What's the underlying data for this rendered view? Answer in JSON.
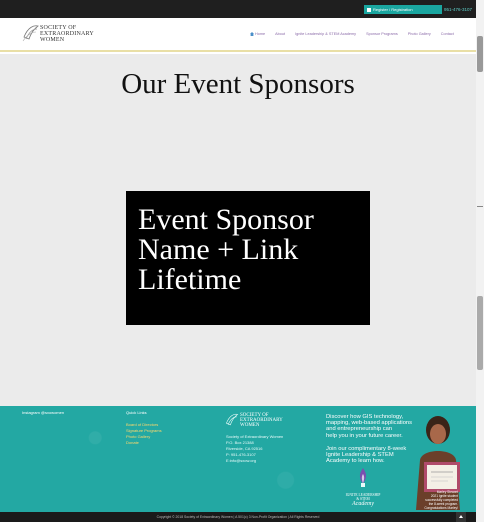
{
  "topbar": {
    "register_label": "Register / Registration",
    "phone": "951-476-3107",
    "lock_icon": "lock-icon"
  },
  "header": {
    "logo_line1": "SOCIETY OF",
    "logo_line2": "EXTRAORDINARY",
    "logo_line3": "WOMEN",
    "nav": [
      {
        "label": "Home",
        "active": true
      },
      {
        "label": "About"
      },
      {
        "label": "Ignite Leadership & STEM Academy"
      },
      {
        "label": "Sponsor Programs"
      },
      {
        "label": "Photo Gallery"
      },
      {
        "label": "Contact"
      }
    ]
  },
  "main": {
    "title": "Our Event Sponsors",
    "sponsor_line1": "Event Sponsor",
    "sponsor_line2": "Name + Link",
    "sponsor_line3": "Lifetime"
  },
  "footer": {
    "instagram_label": "Instagram @sxowomen",
    "quick_links_title": "Quick Links",
    "quick_links": [
      "Board of Directors",
      "Signature Programs",
      "Photo Gallery",
      "Donate"
    ],
    "logo_line1": "SOCIETY OF",
    "logo_line2": "EXTRAORDINARY",
    "logo_line3": "WOMEN",
    "address_line1": "Society of Extraordinary Women",
    "address_line2": "P.O. Box 21388",
    "address_line3": "Riverside, CA 92516",
    "address_line4": "P: 951-476-3107",
    "address_line5": "E:info@sxow.org",
    "promo_lines": [
      "Discover how GIS technology,",
      "mapping, web-based applications",
      "and entrepreneurship can",
      "help you in your future career."
    ],
    "promo2_lines": [
      "Join our complimentary 8-week",
      "Ignite Leadership & STEM",
      "Academy to learn how."
    ],
    "ignite_line1": "IGNITE LEADERSHIP",
    "ignite_line2": "& STEM",
    "ignite_line3": "Academy",
    "cert_lines": [
      "Marley Stewart",
      "2021 Ignite student",
      "successfully completed",
      "the 8-week program.",
      "Congratulations Marley!"
    ]
  },
  "bottom": {
    "copyright": "Copyright © 2018 Society of Extraordinary Women | A 501(c) 3 Non-Profit Organization | All Rights Reserved"
  },
  "colors": {
    "teal": "#23a8a3",
    "dark": "#1f1f1f",
    "gold_rule": "#e9dfa6",
    "nav_purple": "#8a6aa8"
  }
}
